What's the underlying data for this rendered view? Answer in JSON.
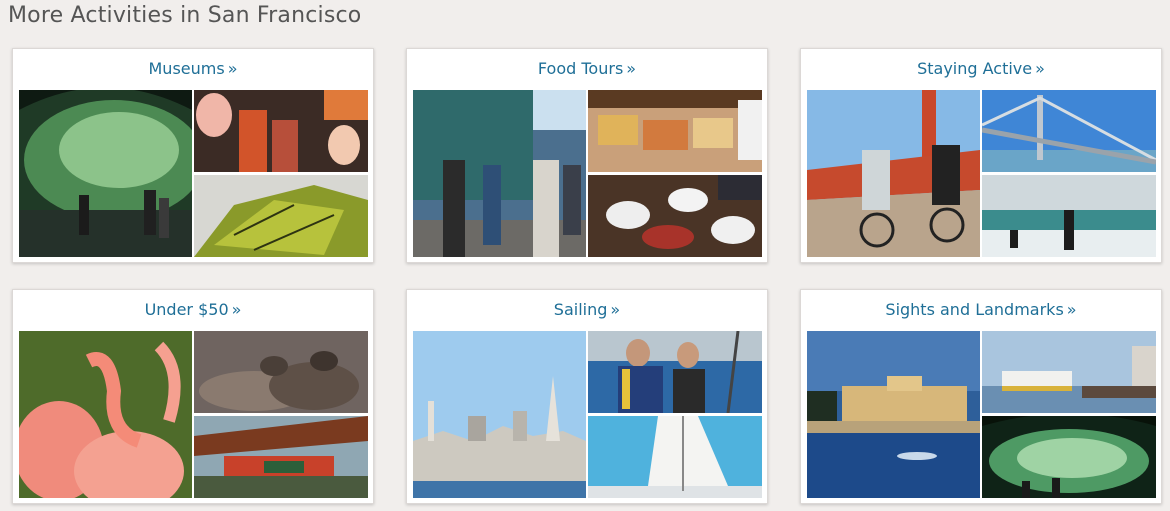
{
  "page": {
    "title": "More Activities in San Francisco"
  },
  "cards": [
    {
      "label": "Museums",
      "suffix": "»"
    },
    {
      "label": "Food Tours",
      "suffix": "»"
    },
    {
      "label": "Staying Active",
      "suffix": "»"
    },
    {
      "label": "Under $50",
      "suffix": "»"
    },
    {
      "label": "Sailing",
      "suffix": "»"
    },
    {
      "label": "Sights and Landmarks",
      "suffix": "»"
    }
  ],
  "colors": {
    "link": "#1f6f97",
    "heading": "#555555",
    "background": "#f1eeec"
  }
}
